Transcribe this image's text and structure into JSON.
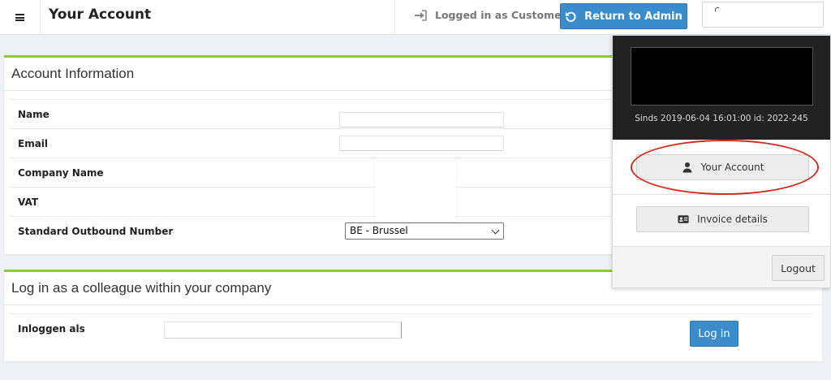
{
  "topbar": {
    "title": "Your Account",
    "logged_in_text": "Logged in as Customer",
    "return_button_label": "Return to Admin"
  },
  "account_panel": {
    "title": "Account Information",
    "rows": [
      {
        "label": "Name"
      },
      {
        "label": "Email"
      },
      {
        "label": "Company Name"
      },
      {
        "label": "VAT"
      },
      {
        "label": "Standard Outbound Number"
      }
    ],
    "outbound_number_selected": "BE - Brussel"
  },
  "colleague_panel": {
    "title": "Log in as a colleague within your company",
    "field_label": "Inloggen als",
    "login_button_label": "Log in"
  },
  "user_dropdown": {
    "since_text": "Sinds 2019-06-04 16:01:00 id: 2022-245",
    "your_account_label": "Your Account",
    "invoice_details_label": "Invoice details",
    "logout_label": "Logout"
  },
  "colors": {
    "accent_green": "#8dc63f",
    "primary_blue": "#3a8ccb",
    "highlight_red": "#d42a20"
  },
  "icons": {
    "menu": "hamburger-icon",
    "logged_in": "sign-in-icon",
    "return": "undo-icon",
    "your_account": "user-icon",
    "invoice_details": "id-card-icon"
  }
}
